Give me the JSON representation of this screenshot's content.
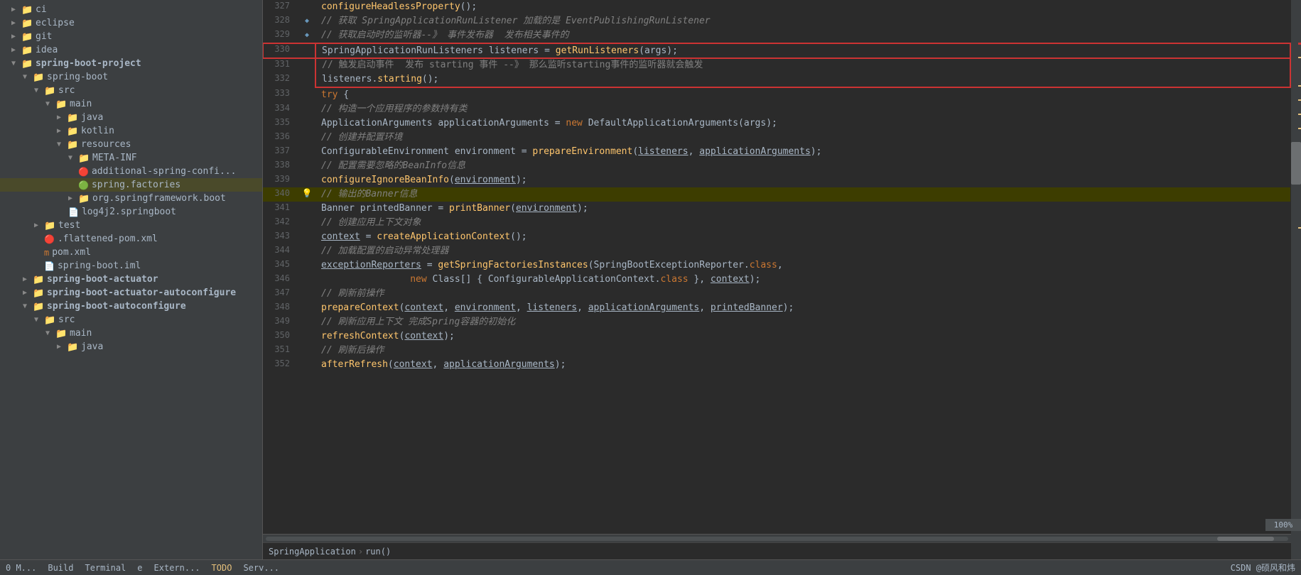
{
  "sidebar": {
    "items": [
      {
        "id": "ci",
        "label": "ci",
        "type": "folder",
        "level": 1,
        "expanded": false,
        "arrow": "▶"
      },
      {
        "id": "eclipse",
        "label": "eclipse",
        "type": "folder",
        "level": 1,
        "expanded": false,
        "arrow": "▶"
      },
      {
        "id": "git",
        "label": "git",
        "type": "folder",
        "level": 1,
        "expanded": false,
        "arrow": "▶"
      },
      {
        "id": "idea",
        "label": "idea",
        "type": "folder",
        "level": 1,
        "expanded": false,
        "arrow": "▶"
      },
      {
        "id": "spring-boot-project",
        "label": "spring-boot-project",
        "type": "folder",
        "level": 1,
        "expanded": true,
        "arrow": "▼",
        "bold": true
      },
      {
        "id": "spring-boot",
        "label": "spring-boot",
        "type": "folder",
        "level": 2,
        "expanded": true,
        "arrow": "▼"
      },
      {
        "id": "src",
        "label": "src",
        "type": "folder",
        "level": 3,
        "expanded": true,
        "arrow": "▼"
      },
      {
        "id": "main",
        "label": "main",
        "type": "folder",
        "level": 4,
        "expanded": true,
        "arrow": "▼"
      },
      {
        "id": "java",
        "label": "java",
        "type": "folder",
        "level": 5,
        "expanded": false,
        "arrow": "▶"
      },
      {
        "id": "kotlin",
        "label": "kotlin",
        "type": "folder",
        "level": 5,
        "expanded": false,
        "arrow": "▶"
      },
      {
        "id": "resources",
        "label": "resources",
        "type": "folder",
        "level": 5,
        "expanded": true,
        "arrow": "▼"
      },
      {
        "id": "META-INF",
        "label": "META-INF",
        "type": "folder",
        "level": 6,
        "expanded": true,
        "arrow": "▼"
      },
      {
        "id": "additional-spring-confi",
        "label": "additional-spring-confi...",
        "type": "file",
        "level": 7,
        "fileIcon": "xml"
      },
      {
        "id": "spring.factories",
        "label": "spring.factories",
        "type": "file",
        "level": 7,
        "fileIcon": "factories",
        "selected": true
      },
      {
        "id": "org.springframework.boot",
        "label": "org.springframework.boot",
        "type": "folder",
        "level": 6,
        "expanded": false,
        "arrow": "▶"
      },
      {
        "id": "log4j2.springboot",
        "label": "log4j2.springboot",
        "type": "file",
        "level": 6,
        "fileIcon": "spring"
      },
      {
        "id": "test",
        "label": "test",
        "type": "folder",
        "level": 3,
        "expanded": false,
        "arrow": "▶"
      },
      {
        "id": ".flattened-pom.xml",
        "label": ".flattened-pom.xml",
        "type": "file",
        "level": 3,
        "fileIcon": "xml"
      },
      {
        "id": "pom.xml",
        "label": "pom.xml",
        "type": "file",
        "level": 3,
        "fileIcon": "pom"
      },
      {
        "id": "spring-boot.iml",
        "label": "spring-boot.iml",
        "type": "file",
        "level": 3,
        "fileIcon": "iml"
      },
      {
        "id": "spring-boot-actuator",
        "label": "spring-boot-actuator",
        "type": "folder",
        "level": 2,
        "expanded": false,
        "arrow": "▶",
        "bold": true
      },
      {
        "id": "spring-boot-actuator-autoconfigure",
        "label": "spring-boot-actuator-autoconfigure",
        "type": "folder",
        "level": 2,
        "expanded": false,
        "arrow": "▶",
        "bold": true
      },
      {
        "id": "spring-boot-autoconfigure",
        "label": "spring-boot-autoconfigure",
        "type": "folder",
        "level": 2,
        "expanded": true,
        "arrow": "▼",
        "bold": true
      },
      {
        "id": "src2",
        "label": "src",
        "type": "folder",
        "level": 3,
        "expanded": true,
        "arrow": "▼"
      },
      {
        "id": "main2",
        "label": "main",
        "type": "folder",
        "level": 4,
        "expanded": true,
        "arrow": "▼"
      },
      {
        "id": "java2",
        "label": "java",
        "type": "folder",
        "level": 5,
        "expanded": false,
        "arrow": "▶"
      }
    ]
  },
  "editor": {
    "lines": [
      {
        "num": 327,
        "gutter": "",
        "code": "configureHeadlessProperty();",
        "indent": 12,
        "type": "normal"
      },
      {
        "num": 328,
        "gutter": "arrow",
        "code": "// 获取 SpringApplicationRunListener 加载的是 EventPublishingRunListener",
        "indent": 12,
        "type": "comment"
      },
      {
        "num": 329,
        "gutter": "arrow2",
        "code": "// 获取启动时的监听器--》 事件发布器  发布相关事件的",
        "indent": 12,
        "type": "comment"
      },
      {
        "num": 330,
        "gutter": "",
        "code": "SpringApplicationRunListeners listeners = getRunListeners(args);",
        "indent": 8,
        "type": "redbox-start"
      },
      {
        "num": 331,
        "gutter": "",
        "code": "// 触发启动事件  发布 starting 事件 --》 那么监听starting事件的监听器就会触发",
        "indent": 12,
        "type": "redbox-comment"
      },
      {
        "num": 332,
        "gutter": "",
        "code": "listeners.starting();",
        "indent": 12,
        "type": "redbox-end"
      },
      {
        "num": 333,
        "gutter": "",
        "code": "try {",
        "indent": 8,
        "type": "normal"
      },
      {
        "num": 334,
        "gutter": "",
        "code": "// 构造一个应用程序的参数持有类",
        "indent": 12,
        "type": "comment"
      },
      {
        "num": 335,
        "gutter": "",
        "code": "ApplicationArguments applicationArguments = new DefaultApplicationArguments(args);",
        "indent": 12,
        "type": "normal"
      },
      {
        "num": 336,
        "gutter": "",
        "code": "// 创建并配置环境",
        "indent": 12,
        "type": "comment"
      },
      {
        "num": 337,
        "gutter": "",
        "code": "ConfigurableEnvironment environment = prepareEnvironment(listeners, applicationArguments);",
        "indent": 12,
        "type": "normal"
      },
      {
        "num": 338,
        "gutter": "",
        "code": "// 配置需要忽略的BeanInfo信息",
        "indent": 12,
        "type": "comment"
      },
      {
        "num": 339,
        "gutter": "",
        "code": "configureIgnoreBeanInfo(environment);",
        "indent": 12,
        "type": "normal"
      },
      {
        "num": 340,
        "gutter": "bulb",
        "code": "// 输出的Banner信息",
        "indent": 12,
        "type": "comment-yellow"
      },
      {
        "num": 341,
        "gutter": "",
        "code": "Banner printedBanner = printBanner(environment);",
        "indent": 12,
        "type": "normal"
      },
      {
        "num": 342,
        "gutter": "",
        "code": "// 创建应用上下文对象",
        "indent": 12,
        "type": "comment"
      },
      {
        "num": 343,
        "gutter": "",
        "code": "context = createApplicationContext();",
        "indent": 12,
        "type": "normal"
      },
      {
        "num": 344,
        "gutter": "",
        "code": "// 加载配置的启动异常处理器",
        "indent": 12,
        "type": "comment"
      },
      {
        "num": 345,
        "gutter": "",
        "code": "exceptionReporters = getSpringFactoriesInstances(SpringBootExceptionReporter.class,",
        "indent": 12,
        "type": "normal"
      },
      {
        "num": 346,
        "gutter": "",
        "code": "new Class[] { ConfigurableApplicationContext.class }, context);",
        "indent": 20,
        "type": "normal"
      },
      {
        "num": 347,
        "gutter": "",
        "code": "// 刷新前操作",
        "indent": 12,
        "type": "comment"
      },
      {
        "num": 348,
        "gutter": "",
        "code": "prepareContext(context, environment, listeners, applicationArguments, printedBanner);",
        "indent": 12,
        "type": "normal"
      },
      {
        "num": 349,
        "gutter": "",
        "code": "// 刷新应用上下文 完成Spring容器的初始化",
        "indent": 12,
        "type": "comment"
      },
      {
        "num": 350,
        "gutter": "",
        "code": "refreshContext(context);",
        "indent": 12,
        "type": "normal"
      },
      {
        "num": 351,
        "gutter": "",
        "code": "// 刷新后操作",
        "indent": 12,
        "type": "comment"
      },
      {
        "num": 352,
        "gutter": "",
        "code": "afterRefresh(context, applicationArguments);",
        "indent": 12,
        "type": "normal"
      }
    ]
  },
  "breadcrumb": {
    "items": [
      "SpringApplication",
      "run()"
    ]
  },
  "bottom_bar": {
    "left_items": [
      "0 M...",
      "Build",
      "Terminal",
      "e",
      "Extern...",
      "TODO",
      "Serv..."
    ],
    "right_text": "CSDN @硕风和炜",
    "zoom": "100%"
  },
  "icons": {
    "folder": "📁",
    "file_xml": "🔴",
    "file_factories": "🟢",
    "file_spring": "🔵",
    "bulb": "💡",
    "arrow_right": "➤",
    "arrow_down": "⬇"
  }
}
